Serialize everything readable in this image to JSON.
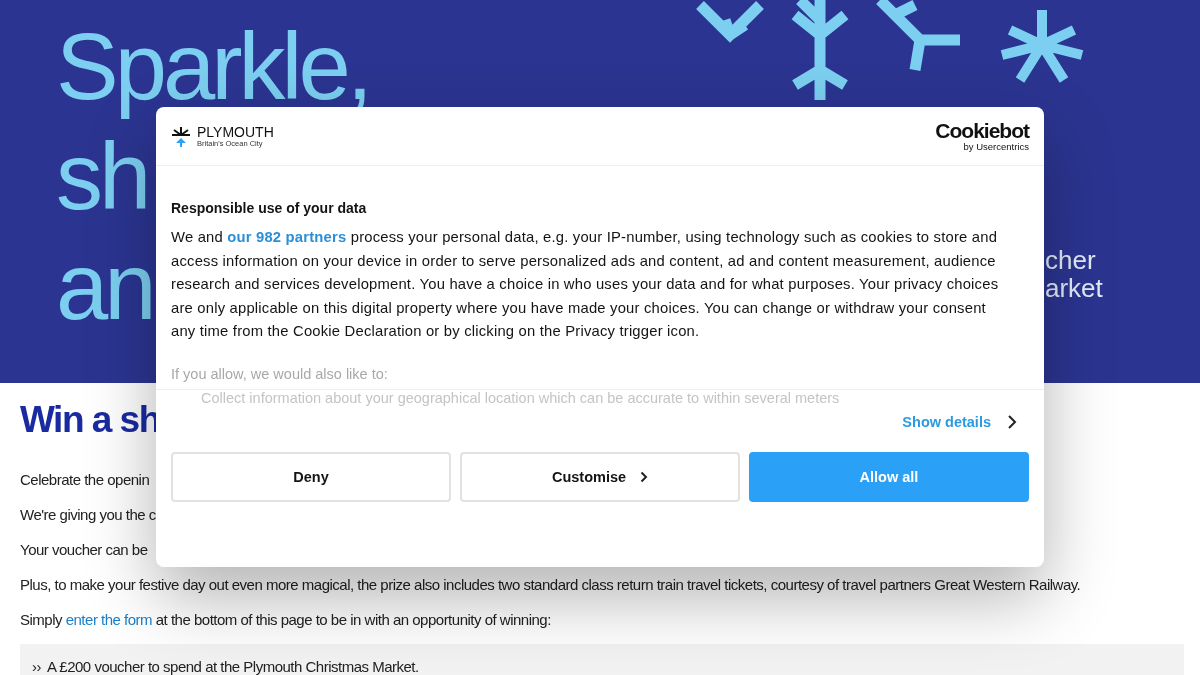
{
  "hero": {
    "headline_lines": [
      "Sparkle,",
      "sh",
      "an"
    ],
    "side_lines": [
      "cher",
      "arket"
    ]
  },
  "article": {
    "heading": "Win a sh",
    "paragraphs": [
      {
        "text": "Celebrate the openin"
      },
      {
        "text": "We're giving you the c"
      },
      {
        "text": "Your voucher can be"
      },
      {
        "text": "Plus, to make your festive day out even more magical, the prize also includes two standard class return train travel tickets, courtesy of travel partners Great Western Railway."
      },
      {
        "text": "Simply ",
        "link": "enter the form",
        "text_after": " at the bottom of this page to be in with an opportunity of winning:"
      }
    ],
    "prize_box": {
      "bullet": "››",
      "text": "A £200 voucher to spend at the Plymouth Christmas Market."
    }
  },
  "cookie_dialog": {
    "logo": {
      "name": "PLYMOUTH",
      "tagline": "Britain's Ocean City"
    },
    "provider": {
      "name": "Cookiebot",
      "by": "by Usercentrics"
    },
    "title": "Responsible use of your data",
    "body": {
      "before": "We and ",
      "link": "our 982 partners",
      "after": " process your personal data, e.g. your IP-number, using technology such as cookies to store and access information on your device in order to serve personalized ads and content, ad and content measurement, audience research and services development. You have a choice in who uses your data and for what purposes. Your privacy choices are only applicable on this digital property where you have made your choices. You can change or withdraw your consent any time from the Cookie Declaration or by clicking on the Privacy trigger icon."
    },
    "also_like": "If you allow, we would also like to:",
    "purposes": [
      "Collect information about your geographical location which can be accurate to within several meters"
    ],
    "show_details": "Show details",
    "buttons": [
      {
        "label": "Deny",
        "kind": "outline",
        "chevron": false
      },
      {
        "label": "Customise",
        "kind": "outline",
        "chevron": true
      },
      {
        "label": "Allow all",
        "kind": "primary",
        "chevron": false
      }
    ]
  }
}
